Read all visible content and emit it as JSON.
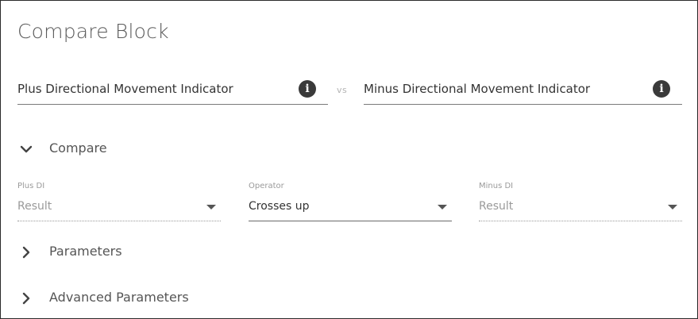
{
  "block": {
    "title": "Compare Block"
  },
  "indicators": {
    "left": {
      "name": "Plus Directional Movement Indicator",
      "icon": "info-icon"
    },
    "separator": "vs",
    "right": {
      "name": "Minus Directional Movement Indicator",
      "icon": "info-icon"
    }
  },
  "compare_section": {
    "label": "Compare",
    "expanded": true,
    "fields": [
      {
        "caption": "Plus DI",
        "value": "Result",
        "is_placeholder": true
      },
      {
        "caption": "Operator",
        "value": "Crosses up",
        "is_placeholder": false
      },
      {
        "caption": "Minus DI",
        "value": "Result",
        "is_placeholder": true
      }
    ]
  },
  "parameters_section": {
    "label": "Parameters",
    "expanded": false
  },
  "advanced_section": {
    "label": "Advanced Parameters",
    "expanded": false
  },
  "colors": {
    "text": "#333333",
    "muted": "#9a9a9a",
    "icon_bg": "#3a3a3a"
  }
}
